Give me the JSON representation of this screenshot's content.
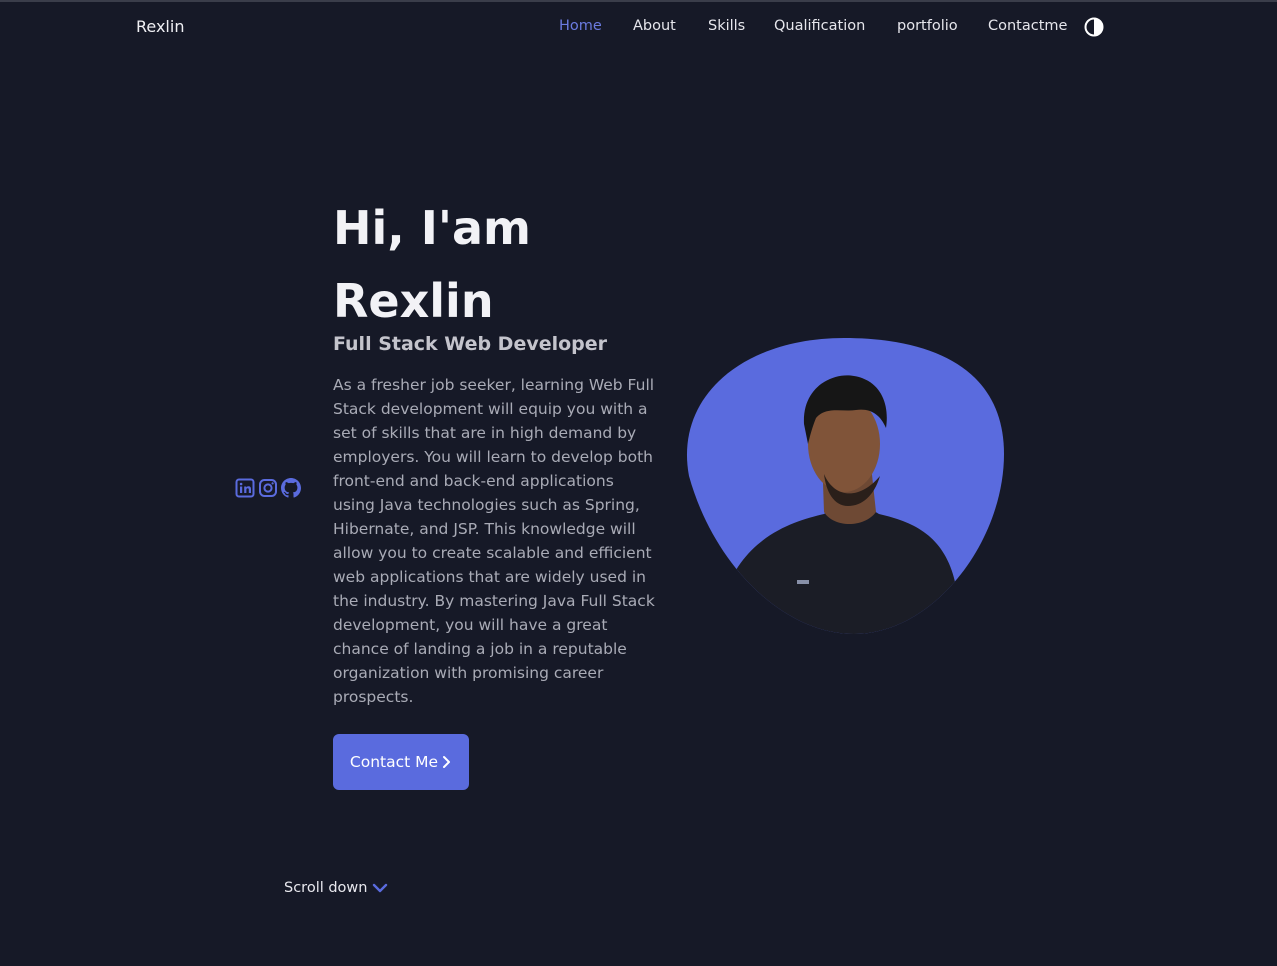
{
  "header": {
    "logo": "Rexlin",
    "nav": [
      {
        "label": "Home",
        "active": true
      },
      {
        "label": "About",
        "active": false
      },
      {
        "label": "Skills",
        "active": false
      },
      {
        "label": "Qualification",
        "active": false
      },
      {
        "label": "portfolio",
        "active": false
      },
      {
        "label": "Contactme",
        "active": false
      }
    ],
    "theme_toggle_icon": "contrast-icon"
  },
  "social": [
    "linkedin-icon",
    "instagram-icon",
    "github-icon"
  ],
  "hero": {
    "title": "Hi, I'am Rexlin",
    "subtitle": "Full Stack Web Developer",
    "description": "As a fresher job seeker, learning Web Full Stack development will equip you with a set of skills that are in high demand by employers. You will learn to develop both front-end and back-end applications using Java technologies such as Spring, Hibernate, and JSP. This knowledge will allow you to create scalable and efficient web applications that are widely used in the industry. By mastering Java Full Stack development, you will have a great chance of landing a job in a reputable organization with promising career prospects.",
    "button_label": "Contact Me",
    "button_icon": "chevron-right-icon"
  },
  "scroll": {
    "label": "Scroll down",
    "icon": "chevron-down-icon"
  },
  "colors": {
    "background": "#161927",
    "accent": "#5a6bde",
    "active_nav": "#6b7be0",
    "text": "#e8e8ee",
    "muted_text": "#a9abb6"
  }
}
